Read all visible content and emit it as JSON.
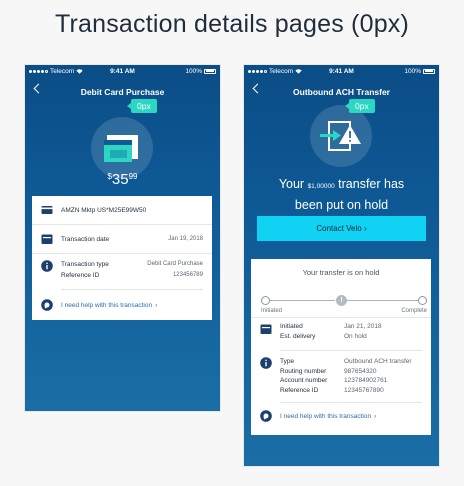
{
  "page_title": "Transaction details pages (0px)",
  "status_bar": {
    "carrier": "Telecom",
    "time": "9:41 AM",
    "battery": "100%"
  },
  "colors": {
    "header_gradient_top": "#0b4d86",
    "header_gradient_bottom": "#1a6ea5",
    "tag": "#2bd6c3",
    "button": "#10d3f4",
    "link": "#2b6cb0",
    "card": "#ffffff"
  },
  "left": {
    "title": "Debit Card Purchase",
    "tag": "0px",
    "amount_dollars": "35",
    "amount_cents": "99",
    "amount_currency": "$",
    "merchant": "AMZN Mktp US*M25E99W50",
    "date_label": "Transaction date",
    "date_value": "Jan 19, 2018",
    "type_label": "Transaction type",
    "type_value": "Debit Card Purchase",
    "ref_label": "Reference ID",
    "ref_value": "123456789",
    "help": "I need help with this transaction"
  },
  "right": {
    "title": "Outbound ACH Transfer",
    "tag": "0px",
    "headline_pre": "Your",
    "headline_amount": "$1,000",
    "headline_cents": "00",
    "headline_post": "transfer has",
    "headline_line2": "been put on hold",
    "button": "Contact Velo",
    "hold_title": "Your transfer is on hold",
    "progress_start": "Initiated",
    "progress_end": "Complete",
    "initiated_label": "Initiated",
    "initiated_value": "Jan 21, 2018",
    "delivery_label": "Est. delivery",
    "delivery_value": "On hold",
    "type_label": "Type",
    "type_value": "Outbound ACH transfer",
    "routing_label": "Routing number",
    "routing_value": "987654320",
    "account_label": "Account number",
    "account_value": "123784902761",
    "ref_label": "Reference ID",
    "ref_value": "12345767890",
    "help": "I need help with this transaction"
  }
}
